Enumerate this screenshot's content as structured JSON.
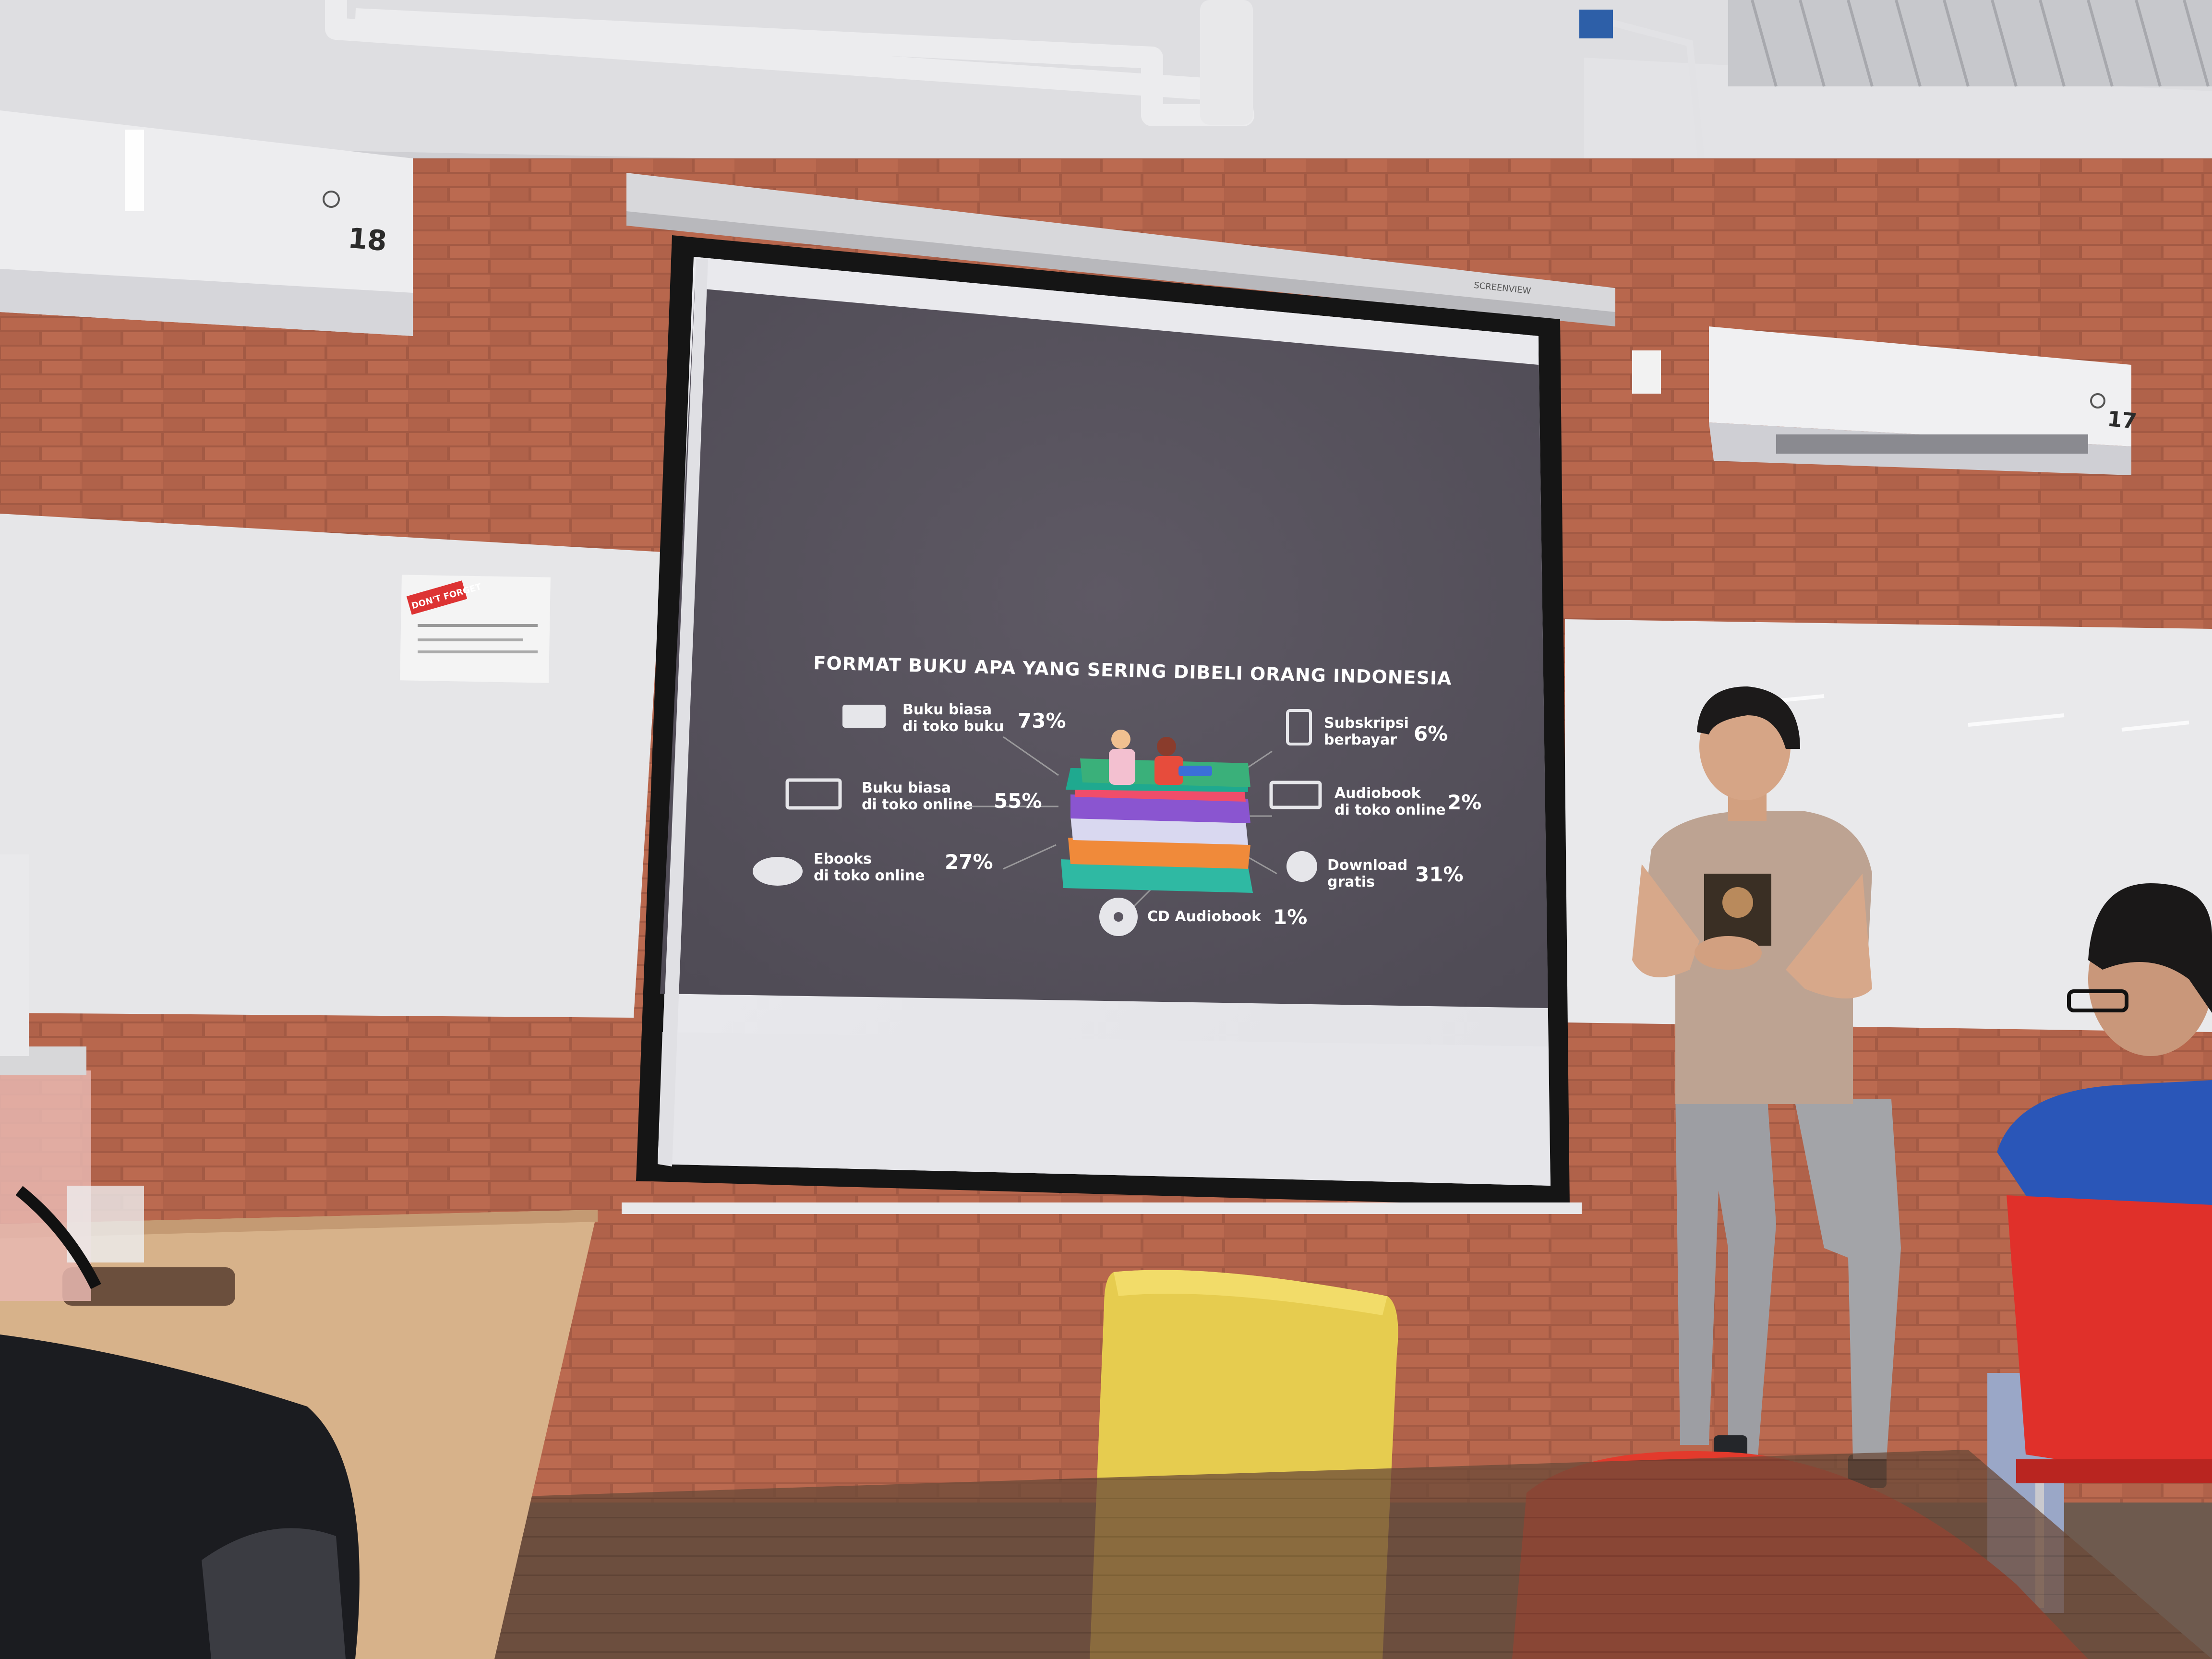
{
  "slide": {
    "title": "FORMAT BUKU APA YANG SERING DIBELI ORANG INDONESIA",
    "items": [
      {
        "line1": "Buku biasa",
        "line2": "di toko buku",
        "percent": "73%",
        "icon": "open-book-icon"
      },
      {
        "line1": "Buku biasa",
        "line2": "di toko online",
        "percent": "55%",
        "icon": "laptop-icon"
      },
      {
        "line1": "Ebooks",
        "line2": "di toko online",
        "percent": "27%",
        "icon": "cloud-download-icon"
      },
      {
        "line1": "Subskripsi",
        "line2": "berbayar",
        "percent": "6%",
        "icon": "tablet-icon"
      },
      {
        "line1": "Audiobook",
        "line2": "di toko online",
        "percent": "2%",
        "icon": "laptop-audio-icon"
      },
      {
        "line1": "Download",
        "line2": "gratis",
        "percent": "31%",
        "icon": "ninja-mask-icon"
      },
      {
        "line1": "CD Audiobook",
        "line2": "",
        "percent": "1%",
        "icon": "cd-icon"
      }
    ]
  },
  "room": {
    "ac_left_number": "18",
    "ac_right_number": "17",
    "screen_brand": "SCREENVIEW",
    "notice_stamp": "DON'T FORGET"
  },
  "colors": {
    "slide_bg": "#5a5560",
    "screen_frame": "#151515",
    "brick": "#b5654b",
    "whiteboard": "#e9e9ea",
    "ceiling": "#d9d9dc",
    "chair_yellow": "#e8cf4e",
    "chair_red": "#e53a2e"
  }
}
